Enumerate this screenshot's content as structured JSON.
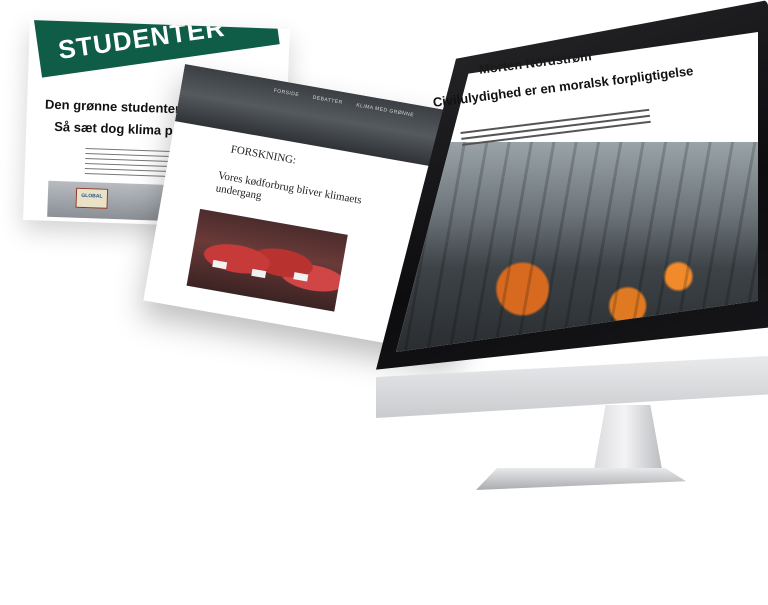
{
  "green_page": {
    "banner_text": "STUDENTER",
    "heading": "Den grønne studenter bevægel",
    "subheading": "Så sæt dog klima på dagsorde",
    "sign_text": "GLOBAL"
  },
  "middle_page": {
    "nav": [
      "FORSIDE",
      "DEBATTER",
      "KLIMA MED GRØNNE"
    ],
    "section_label": "FORSKNING:",
    "article_title": "Vores kødforbrug bliver klimaets undergang"
  },
  "screen_page": {
    "author": "Morten Nördstrøm",
    "title": "Civilulydighed er en moralsk forpligtigelse"
  },
  "colors": {
    "brand_green": "#0f5c47",
    "vest_orange": "#e07a22",
    "monitor_black": "#111114",
    "aluminium": "#d9dadc"
  },
  "icons": {
    "leaf": "leaf-icon"
  }
}
